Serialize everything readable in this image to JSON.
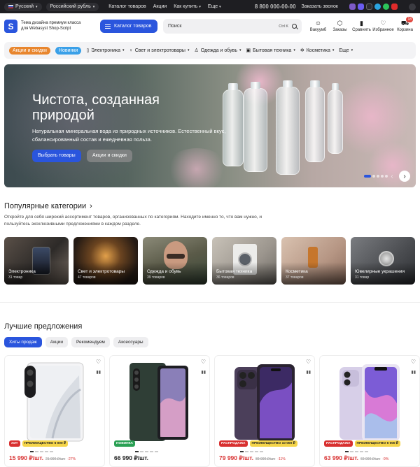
{
  "topbar": {
    "language": "Русский",
    "currency": "Российский рубль",
    "links": [
      "Каталог товаров",
      "Акции",
      "Как купить",
      "Еще"
    ],
    "phone": "8 800 000-00-00",
    "callback": "Заказать звонок"
  },
  "header": {
    "logo_letter": "S",
    "tagline": "Тема дизайна премиум класса для Webasyst Shop-Script",
    "catalog_button": "Каталог товаров",
    "search_placeholder": "Поиск",
    "search_shortcut": "Ctrl K",
    "icons": [
      {
        "label": "Вакуумб",
        "icon": "user-icon"
      },
      {
        "label": "Заказы",
        "icon": "box-icon"
      },
      {
        "label": "Сравнить",
        "icon": "compare-icon"
      },
      {
        "label": "Избранное",
        "icon": "heart-icon"
      },
      {
        "label": "Корзина",
        "icon": "cart-icon",
        "badge": "18"
      }
    ]
  },
  "nav": {
    "tag_sales": "Акции и скидки",
    "tag_new": "Новинки",
    "items": [
      "Электроника",
      "Свет и электротовары",
      "Одежда и обувь",
      "Бытовая техника",
      "Косметика",
      "Еще"
    ]
  },
  "hero": {
    "title": "Чистота, созданная природой",
    "text": "Натуральная минеральная вода из природных источников. Естественный вкус, сбалансированный состав и ежедневная польза.",
    "primary_button": "Выбрать товары",
    "secondary_button": "Акции и скидки"
  },
  "categories": {
    "title": "Популярные категории",
    "description": "Откройте для себя широкий ассортимент товаров, организованных по категориям. Находите именно то, что вам нужно, и пользуйтесь эксклюзивными предложениями в каждом разделе.",
    "items": [
      {
        "name": "Электроника",
        "count": "31 товар"
      },
      {
        "name": "Свет и электротовары",
        "count": "47 товаров"
      },
      {
        "name": "Одежда и обувь",
        "count": "39 товаров"
      },
      {
        "name": "Бытовая техника",
        "count": "36 товаров"
      },
      {
        "name": "Косметика",
        "count": "37 товаров"
      },
      {
        "name": "Ювелирные украшения",
        "count": "31 товар"
      }
    ]
  },
  "offers": {
    "title": "Лучшие предложения",
    "tabs": [
      "Хиты продаж",
      "Акции",
      "Рекомендуем",
      "Аксессуары"
    ],
    "products": [
      {
        "badges": [
          {
            "text": "ХИТ",
            "color": "red"
          },
          {
            "text": "ПРЕИМУЩЕСТВО 6 000 ₽",
            "color": "yellow"
          }
        ],
        "price": "15 990 ₽/шт.",
        "old": "21 990 ₽/шт.",
        "pct": "-27%"
      },
      {
        "badges": [
          {
            "text": "НОВИНКА",
            "color": "green"
          }
        ],
        "price": "66 990 ₽/шт.",
        "old": "",
        "pct": ""
      },
      {
        "badges": [
          {
            "text": "РАСПРОДАЖА",
            "color": "red"
          },
          {
            "text": "ПРЕИМУЩЕСТВО 10 000 ₽",
            "color": "yellow"
          }
        ],
        "price": "79 990 ₽/шт.",
        "old": "89 990 ₽/шт.",
        "pct": "-11%"
      },
      {
        "badges": [
          {
            "text": "РАСПРОДАЖА",
            "color": "red"
          },
          {
            "text": "ПРЕИМУЩЕСТВО 6 000 ₽",
            "color": "yellow"
          }
        ],
        "price": "63 990 ₽/шт.",
        "old": "69 990 ₽/шт.",
        "pct": "-9%"
      }
    ]
  },
  "colors": {
    "accent": "#2a55dd",
    "sale": "#d83030",
    "orange_tag": "#e8862e",
    "blue_tag": "#3aa0e8"
  }
}
